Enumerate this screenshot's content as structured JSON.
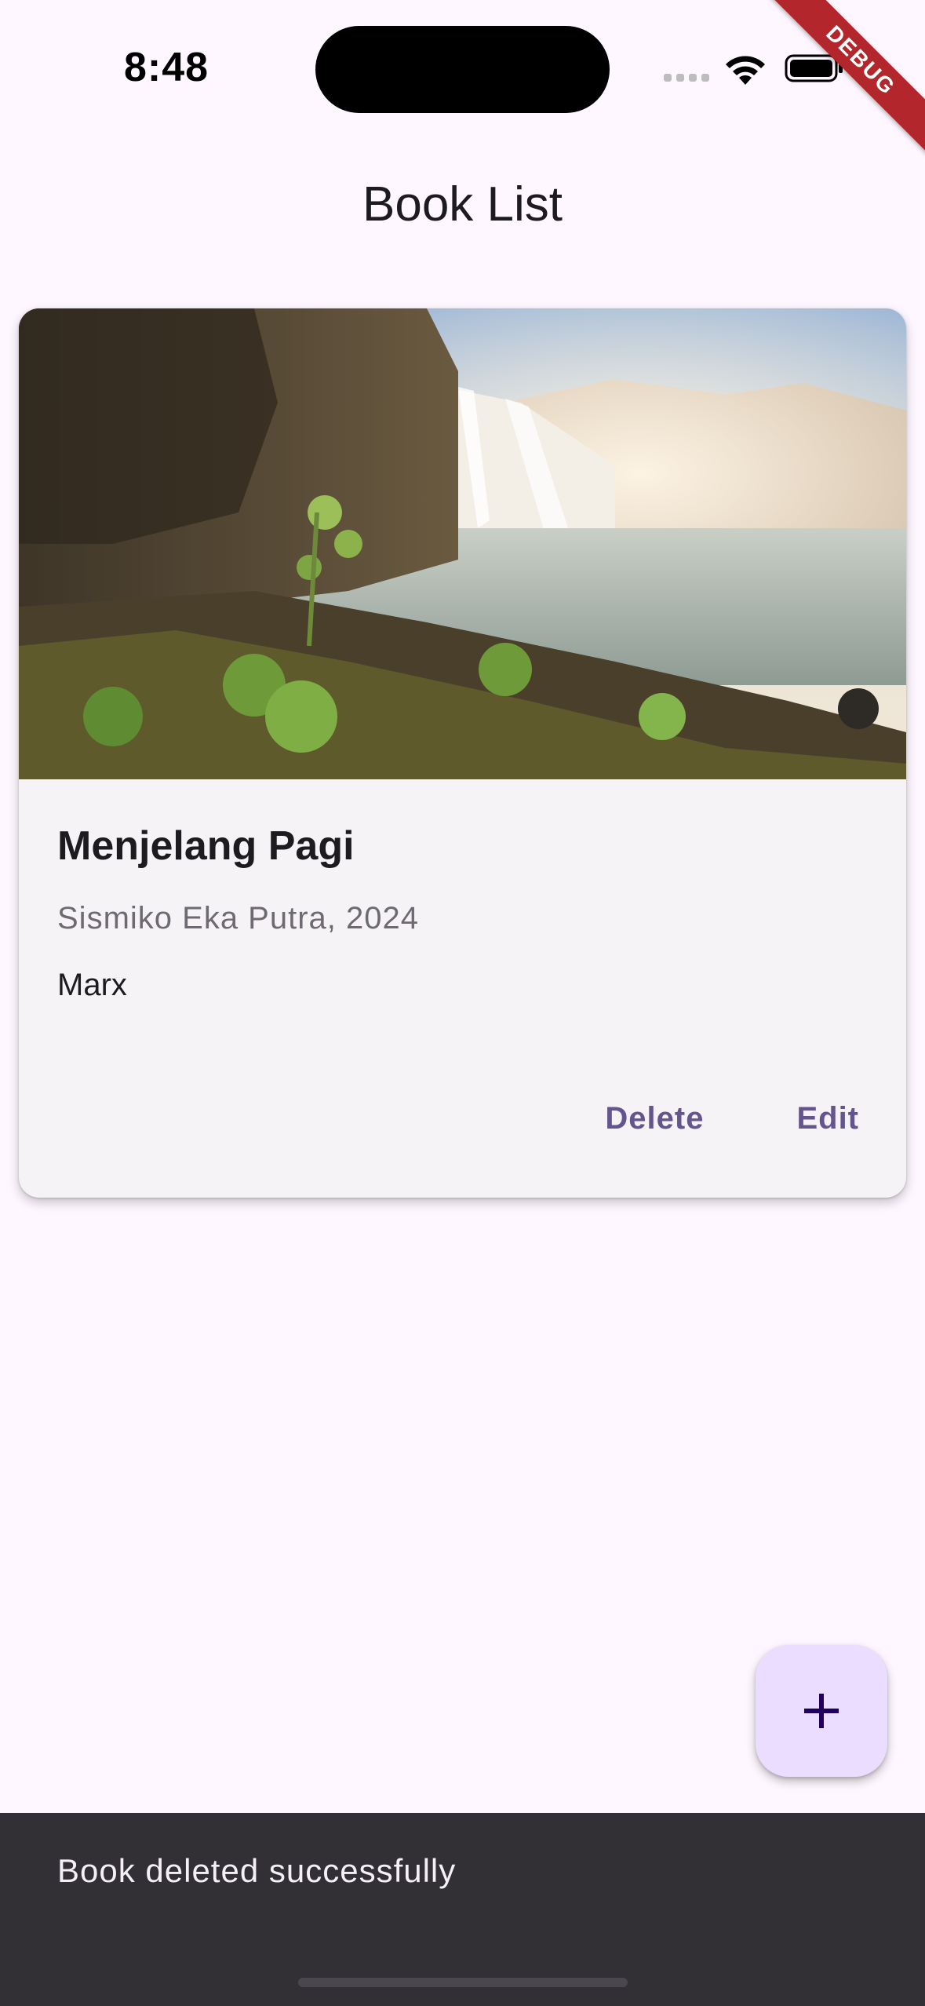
{
  "status_bar": {
    "time": "8:48",
    "wifi_icon": "wifi-icon",
    "battery_icon": "battery-icon",
    "debug_label": "DEBUG"
  },
  "app_bar": {
    "title": "Book List"
  },
  "books": [
    {
      "image": "waterfall-landscape-photo",
      "title": "Menjelang Pagi",
      "meta": "Sismiko Eka Putra, 2024",
      "description": "Marx",
      "actions": {
        "delete_label": "Delete",
        "edit_label": "Edit"
      }
    }
  ],
  "fab": {
    "icon": "plus-icon"
  },
  "snackbar": {
    "message": "Book deleted successfully"
  },
  "colors": {
    "background": "#FEF7FF",
    "card": "#F6F3F7",
    "accent": "#65558F",
    "fab": "#EADDFF",
    "snackbar": "#322F35",
    "debug_banner": "#B3262B"
  }
}
